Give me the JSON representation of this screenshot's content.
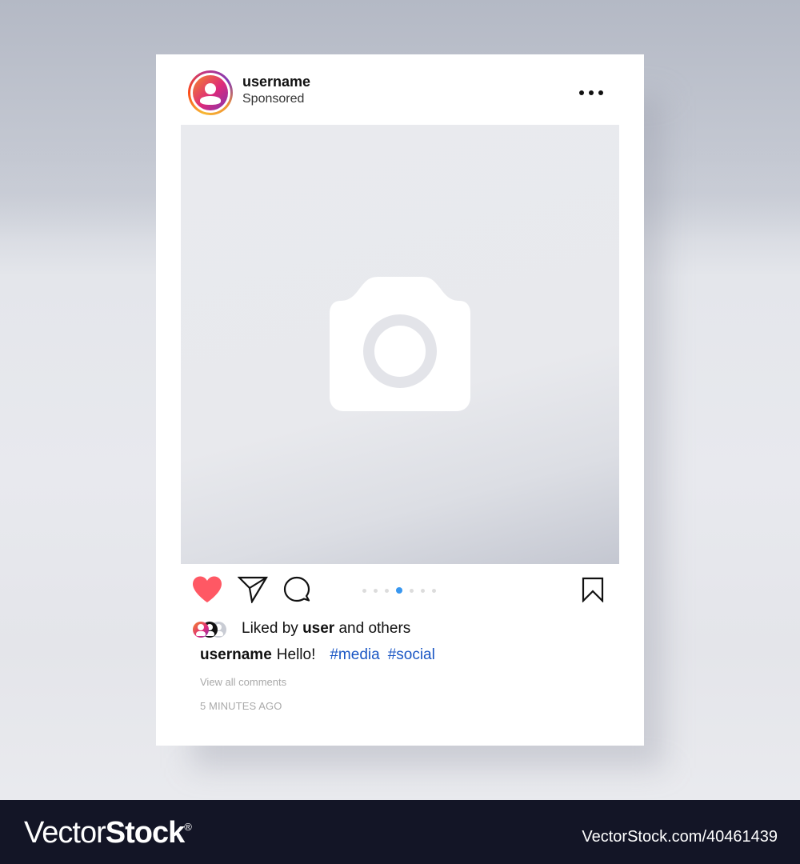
{
  "post": {
    "header": {
      "username": "username",
      "subtitle": "Sponsored",
      "avatar_icon": "user-avatar-icon",
      "more_icon": "more-horizontal-icon"
    },
    "media": {
      "placeholder_icon": "camera-icon",
      "carousel": {
        "total": 7,
        "active_index": 3
      }
    },
    "actions": {
      "like_icon": "heart-icon",
      "share_icon": "send-icon",
      "comment_icon": "comment-icon",
      "save_icon": "bookmark-icon",
      "liked": true
    },
    "likes": {
      "prefix": "Liked by",
      "user": "user",
      "suffix": "and others"
    },
    "caption": {
      "username": "username",
      "text": "Hello!",
      "hashtags": [
        "#media",
        "#social"
      ]
    },
    "view_comments": "View all comments",
    "time_ago": "5 MINUTES AGO"
  },
  "colors": {
    "like": "#ff5864",
    "hashtag": "#1a56c4",
    "active_dot": "#3897f0",
    "inactive_dot": "#dcdcdc",
    "muted_text": "#a9a9a9"
  },
  "watermark": {
    "brand_light": "Vector",
    "brand_bold": "Stock",
    "registered": "®",
    "id_text": "VectorStock.com/40461439"
  }
}
